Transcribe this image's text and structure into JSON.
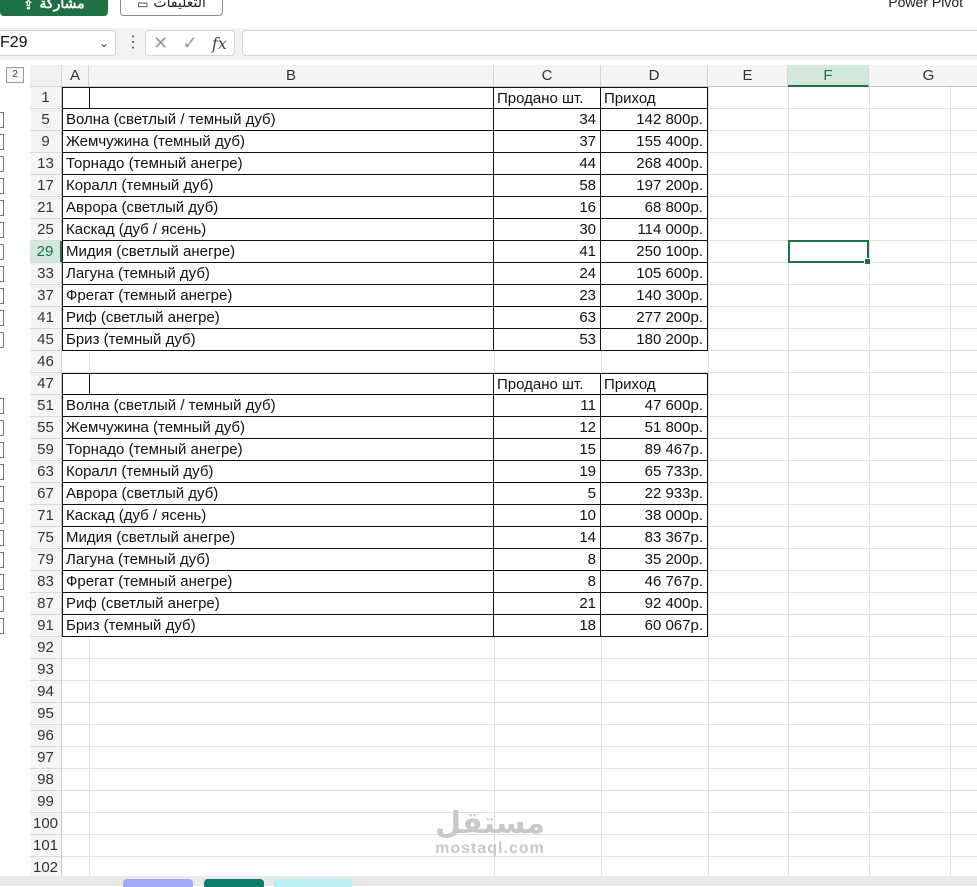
{
  "toolbar": {
    "share_label": "مشاركة",
    "comments_label": "التعليقات",
    "power_pivot": "Power Pivot"
  },
  "formula_bar": {
    "name_box": "F29",
    "fx": "fx",
    "formula": ""
  },
  "outline": {
    "level_2": "2"
  },
  "columns": [
    "A",
    "B",
    "C",
    "D",
    "E",
    "F",
    "G"
  ],
  "selected_column": "F",
  "selected_row": "29",
  "table1": {
    "header_row": "1",
    "headers": {
      "c": "Продано шт.",
      "d": "Приход"
    },
    "rows": [
      {
        "row": "5",
        "name": "Волна (светлый / темный дуб)",
        "sold": "34",
        "income": "142 800р."
      },
      {
        "row": "9",
        "name": "Жемчужина (темный дуб)",
        "sold": "37",
        "income": "155 400р."
      },
      {
        "row": "13",
        "name": "Торнадо (темный анегре)",
        "sold": "44",
        "income": "268 400р."
      },
      {
        "row": "17",
        "name": "Коралл (темный дуб)",
        "sold": "58",
        "income": "197 200р."
      },
      {
        "row": "21",
        "name": "Аврора (светлый дуб)",
        "sold": "16",
        "income": "68 800р."
      },
      {
        "row": "25",
        "name": "Каскад (дуб / ясень)",
        "sold": "30",
        "income": "114 000р."
      },
      {
        "row": "29",
        "name": "Мидия (светлый анегре)",
        "sold": "41",
        "income": "250 100р."
      },
      {
        "row": "33",
        "name": "Лагуна (темный дуб)",
        "sold": "24",
        "income": "105 600р."
      },
      {
        "row": "37",
        "name": "Фрегат (темный анегре)",
        "sold": "23",
        "income": "140 300р."
      },
      {
        "row": "41",
        "name": "Риф (светлый анегре)",
        "sold": "63",
        "income": "277 200р."
      },
      {
        "row": "45",
        "name": "Бриз (темный дуб)",
        "sold": "53",
        "income": "180 200р."
      }
    ]
  },
  "blank_row": "46",
  "table2": {
    "header_row": "47",
    "headers": {
      "c": "Продано шт.",
      "d": "Приход"
    },
    "rows": [
      {
        "row": "51",
        "name": "Волна (светлый / темный дуб)",
        "sold": "11",
        "income": "47 600р."
      },
      {
        "row": "55",
        "name": "Жемчужина (темный дуб)",
        "sold": "12",
        "income": "51 800р."
      },
      {
        "row": "59",
        "name": "Торнадо (темный анегре)",
        "sold": "15",
        "income": "89 467р."
      },
      {
        "row": "63",
        "name": "Коралл (темный дуб)",
        "sold": "19",
        "income": "65 733р."
      },
      {
        "row": "67",
        "name": "Аврора (светлый дуб)",
        "sold": "5",
        "income": "22 933р."
      },
      {
        "row": "71",
        "name": "Каскад (дуб / ясень)",
        "sold": "10",
        "income": "38 000р."
      },
      {
        "row": "75",
        "name": "Мидия (светлый анегре)",
        "sold": "14",
        "income": "83 367р."
      },
      {
        "row": "79",
        "name": "Лагуна (темный дуб)",
        "sold": "8",
        "income": "35 200р."
      },
      {
        "row": "83",
        "name": "Фрегат (темный анегре)",
        "sold": "8",
        "income": "46 767р."
      },
      {
        "row": "87",
        "name": "Риф (светлый анегре)",
        "sold": "21",
        "income": "92 400р."
      },
      {
        "row": "91",
        "name": "Бриз (темный дуб)",
        "sold": "18",
        "income": "60 067р."
      }
    ]
  },
  "empty_rows": [
    "92",
    "93",
    "94",
    "95",
    "96",
    "97",
    "98",
    "99",
    "100",
    "101",
    "102"
  ],
  "watermark": {
    "arabic": "مستقل",
    "latin": "mostaql.com"
  },
  "colors": {
    "accent": "#1e7145",
    "selected_header": "#d3e7db",
    "tab1": "#a5a8f5",
    "tab2": "#0f7b6c",
    "tab3": "#b9f0f5"
  }
}
